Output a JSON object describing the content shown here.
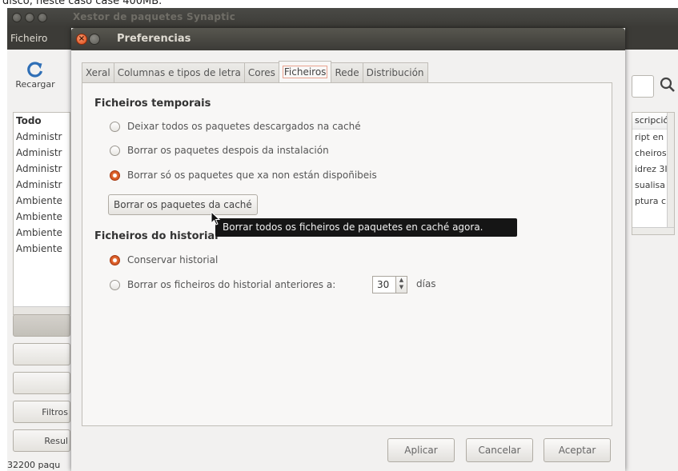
{
  "caption": "disco, neste caso case 400MB.",
  "main_window": {
    "title": "Xestor de paquetes Synaptic",
    "menu": [
      "Ficheiro"
    ],
    "toolbar": {
      "reload_label": "Recargar",
      "reload_icon": "reload-icon",
      "search_icon": "search-icon"
    },
    "filter_list": {
      "header": "Todo",
      "items": [
        "Administr",
        "Administr",
        "Administr",
        "Administr",
        "Ambiente",
        "Ambiente",
        "Ambiente",
        "Ambiente"
      ]
    },
    "side_buttons": [
      "",
      "",
      "",
      "Filtros",
      "Resul"
    ],
    "status": "32200 paqu",
    "package_pane": {
      "header": "scripció",
      "rows": [
        "ript en",
        "cheiros",
        "idrez 3I",
        "sualisa",
        "ptura c"
      ]
    }
  },
  "dialog": {
    "title": "Preferencias",
    "tabs": [
      "Xeral",
      "Columnas e tipos de letra",
      "Cores",
      "Ficheiros",
      "Rede",
      "Distribución"
    ],
    "active_tab": "Ficheiros",
    "temp_section": {
      "title": "Ficheiros temporais",
      "options": [
        {
          "label": "Deixar todos os paquetes descargados na caché",
          "checked": false
        },
        {
          "label": "Borrar os paquetes despois da instalación",
          "checked": false
        },
        {
          "label": "Borrar só os paquetes que xa non están dispoñibeis",
          "checked": true
        }
      ],
      "delete_button": "Borrar os paquetes da caché"
    },
    "tooltip": "Borrar todos os ficheiros de paquetes en caché agora.",
    "history_section": {
      "title": "Ficheiros do historial",
      "keep_label": "Conservar historial",
      "keep_checked": true,
      "delete_label": "Borrar os ficheiros do historial anteriores a:",
      "delete_checked": false,
      "days_value": "30",
      "days_unit": "días"
    },
    "buttons": {
      "apply": "Aplicar",
      "cancel": "Cancelar",
      "ok": "Aceptar"
    },
    "colors": {
      "accent_radio": "#e2672e",
      "titlebar": "#3c3b37"
    }
  }
}
